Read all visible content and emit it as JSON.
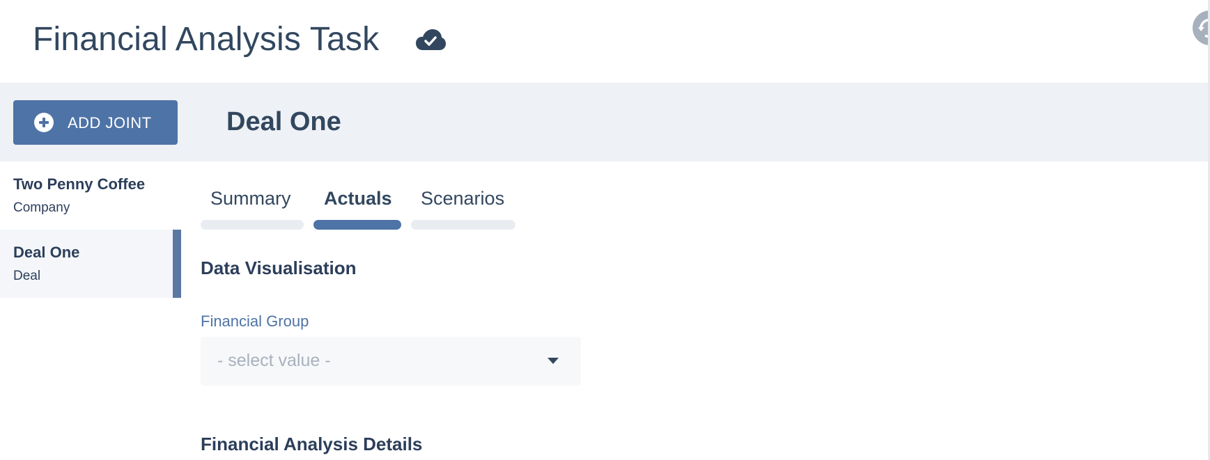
{
  "header": {
    "title": "Financial Analysis Task",
    "cloud_icon": "cloud-check-icon",
    "refresh_icon": "refresh-icon"
  },
  "band": {
    "add_button_label": "ADD JOINT",
    "title": "Deal One"
  },
  "sidebar": {
    "items": [
      {
        "name": "Two Penny Coffee",
        "type": "Company",
        "active": false
      },
      {
        "name": "Deal One",
        "type": "Deal",
        "active": true
      }
    ]
  },
  "tabs": [
    {
      "label": "Summary",
      "active": false
    },
    {
      "label": "Actuals",
      "active": true
    },
    {
      "label": "Scenarios",
      "active": false
    }
  ],
  "main": {
    "section1_title": "Data Visualisation",
    "financial_group_label": "Financial Group",
    "financial_group_placeholder": "- select value -",
    "section2_title": "Financial Analysis Details"
  },
  "colors": {
    "accent": "#4e73a6",
    "band_bg": "#eef1f5",
    "text": "#32475f"
  }
}
